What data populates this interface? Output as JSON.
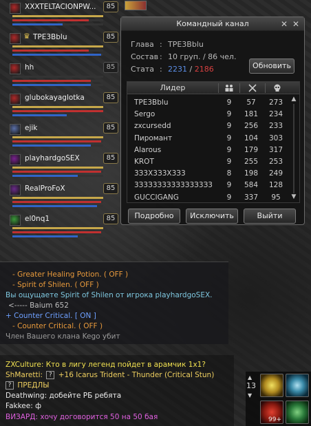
{
  "party": {
    "members": [
      {
        "name": "XXXTELTACIONPW...",
        "level": "85",
        "cp": 1.0,
        "hp": 0.84,
        "mp": 0.55,
        "icon_color": "#b02828",
        "leader": false
      },
      {
        "name": "TPE3Bblu",
        "level": "85",
        "cp": 1.0,
        "hp": 0.84,
        "mp": 0.98,
        "icon_color": "#b02828",
        "leader": true
      },
      {
        "name": "hh",
        "level": "85",
        "cp": 0.0,
        "hp": 0.86,
        "mp": 0.86,
        "icon_color": "#b02828",
        "leader": false
      },
      {
        "name": "glubokayaglotka",
        "level": "85",
        "cp": 1.0,
        "hp": 1.0,
        "mp": 0.6,
        "icon_color": "#b02828",
        "leader": false
      },
      {
        "name": "ejik",
        "level": "85",
        "cp": 1.0,
        "hp": 0.98,
        "mp": 0.86,
        "icon_color": "#5a6fa8",
        "leader": false
      },
      {
        "name": "playhardgoSEX",
        "level": "85",
        "cp": 1.0,
        "hp": 0.98,
        "mp": 0.72,
        "icon_color": "#7a2090",
        "leader": false
      },
      {
        "name": "RealProFoX",
        "level": "85",
        "cp": 1.0,
        "hp": 0.98,
        "mp": 0.93,
        "icon_color": "#6a2a8a",
        "leader": false
      },
      {
        "name": "el0nq1",
        "level": "85",
        "cp": 1.0,
        "hp": 0.98,
        "mp": 0.72,
        "icon_color": "#3a9a3a",
        "leader": false
      }
    ]
  },
  "channel": {
    "title": "Командный канал",
    "leader_label": "Глава",
    "leader_value": "TPE3Bblu",
    "comp_label": "Состав",
    "comp_value": "10 груп. / 86 чел.",
    "stats_label": "Стата",
    "stats_kills": "2231",
    "stats_sep": " / ",
    "stats_deaths": "2186",
    "update_button": "Обновить",
    "col_leader": "Лидер",
    "rows": [
      {
        "name": "TPE3Bblu",
        "groups": "9",
        "kills": "57",
        "deaths": "273"
      },
      {
        "name": "Sergo",
        "groups": "9",
        "kills": "181",
        "deaths": "234"
      },
      {
        "name": "zxcursedd",
        "groups": "9",
        "kills": "256",
        "deaths": "233"
      },
      {
        "name": "Пиромант",
        "groups": "9",
        "kills": "104",
        "deaths": "303"
      },
      {
        "name": "Alarous",
        "groups": "9",
        "kills": "179",
        "deaths": "317"
      },
      {
        "name": "KROT",
        "groups": "9",
        "kills": "255",
        "deaths": "253"
      },
      {
        "name": "3З3X3З3X3З3",
        "groups": "8",
        "kills": "198",
        "deaths": "249"
      },
      {
        "name": "3З3З3З3З3З3З3З3З3",
        "groups": "9",
        "kills": "584",
        "deaths": "128"
      },
      {
        "name": "GUCCIGANG",
        "groups": "9",
        "kills": "337",
        "deaths": "95"
      }
    ],
    "btn_details": "Подробно",
    "btn_exclude": "Исключить",
    "btn_leave": "Выйти"
  },
  "syslog": [
    {
      "text": "- Greater Healing Potion. ( OFF )",
      "color": "#e89a3c"
    },
    {
      "text": "- Spirit of Shilen. ( OFF )",
      "color": "#e89a3c"
    },
    {
      "text": "Вы ощущаете Spirit of Shilen от игрока playhardgoSEX.",
      "color": "#7fc8e0"
    },
    {
      "text": "<----- Baium 652",
      "color": "#bdbdbd"
    },
    {
      "text": "+ Counter Critical. [ ON ]",
      "color": "#6ea0ff"
    },
    {
      "text": "- Counter Critical. ( OFF )",
      "color": "#e89a3c"
    },
    {
      "text": "Член Вашего клана Kego убит",
      "color": "#9a9a9a"
    }
  ],
  "chat": {
    "line1": "ZXCulture: Кто в лигу легенд пойдет в арамчик 1х1?",
    "line2_prefix": "ShMaretti:",
    "line2_item": "+16 Icarus Trident - Thunder (Critical Stun)",
    "line3_item": "ПРЕДЛЫ",
    "line4": "Deathwing: добейте РБ ребята",
    "line5": "Fakkee: ф",
    "line6": "ВИЗАРД: хочу договорится 50 на 50 бая",
    "question_mark": "?"
  },
  "quickbar": {
    "page_number": "13",
    "slot_count_label": "99+"
  }
}
